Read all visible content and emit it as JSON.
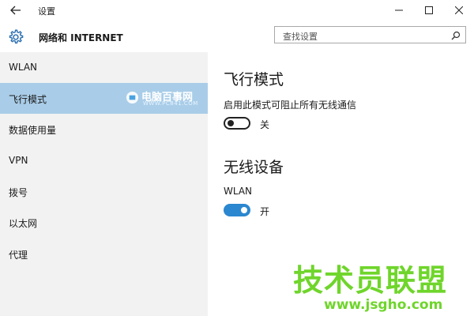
{
  "window": {
    "title": "设置",
    "back_icon": "arrow-left-icon",
    "controls": [
      "minimize-icon",
      "maximize-icon",
      "close-icon"
    ]
  },
  "header": {
    "icon": "gear-icon",
    "title": "网络和 INTERNET",
    "search_placeholder": "查找设置",
    "search_icon": "search-icon"
  },
  "sidebar": {
    "items": [
      {
        "label": "WLAN",
        "active": false
      },
      {
        "label": "飞行模式",
        "active": true
      },
      {
        "label": "数据使用量",
        "active": false
      },
      {
        "label": "VPN",
        "active": false
      },
      {
        "label": "拨号",
        "active": false
      },
      {
        "label": "以太网",
        "active": false
      },
      {
        "label": "代理",
        "active": false
      }
    ],
    "active_color": "#a9cde8",
    "watermark": {
      "text": "电脑百事网",
      "sub": "WWW.PC841.COM"
    }
  },
  "main": {
    "airplane": {
      "title": "飞行模式",
      "description": "启用此模式可阻止所有无线通信",
      "toggle_state": "off",
      "toggle_label": "关"
    },
    "wireless": {
      "title": "无线设备",
      "wlan_label": "WLAN",
      "toggle_state": "on",
      "toggle_label": "开",
      "toggle_color": "#2b87cf"
    }
  },
  "watermark": {
    "text": "技术员联盟",
    "url": "www.jsgho.com",
    "color": "#6fd52b"
  }
}
